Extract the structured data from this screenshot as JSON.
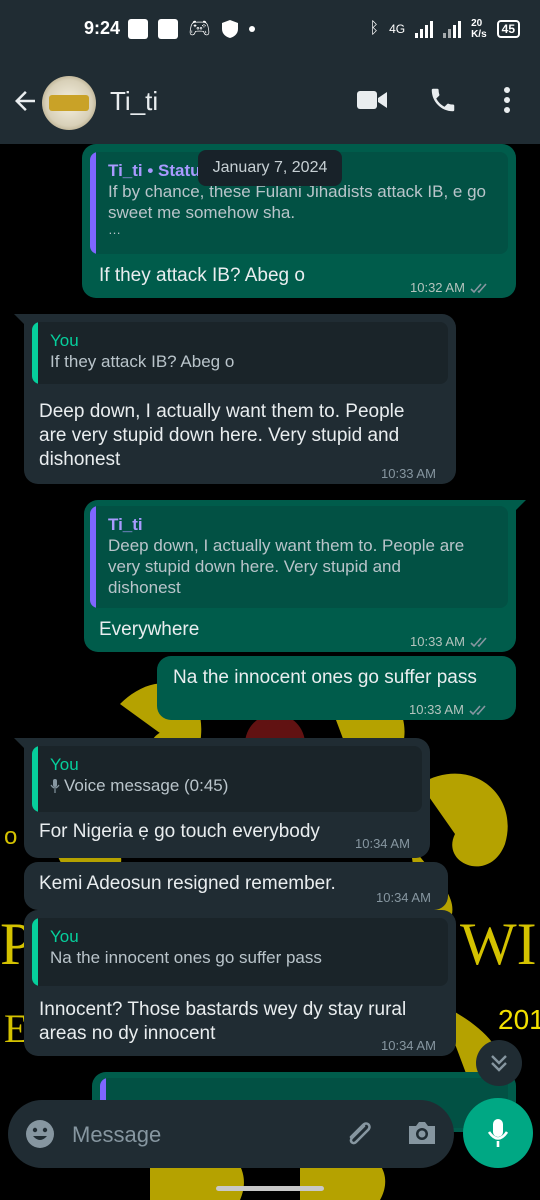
{
  "status_bar": {
    "time": "9:24",
    "network": "4G",
    "speed_value": "20",
    "speed_unit": "K/s",
    "battery": "45"
  },
  "header": {
    "contact_name": "Ti_ti",
    "icons": [
      "back-arrow-icon",
      "video-call-icon",
      "voice-call-icon",
      "more-options-icon"
    ]
  },
  "chat": {
    "date_chip": "January 7, 2024",
    "messages": [
      {
        "direction": "outgoing",
        "quote_author": "Ti_ti • Status",
        "quote_text": "If by chance, these Fulani Jihadists attack IB, e go sweet me somehow sha.",
        "quote_more": "…",
        "text": "If they attack IB? Abeg o",
        "time": "10:32 AM",
        "read": true
      },
      {
        "direction": "incoming",
        "quote_author": "You",
        "quote_text": "If they attack IB? Abeg o",
        "text_lines": [
          "Deep down, I actually want them to. People",
          "are very stupid down here. Very stupid and",
          "dishonest"
        ],
        "time": "10:33 AM"
      },
      {
        "direction": "outgoing",
        "quote_author": "Ti_ti",
        "quote_text_lines": [
          "Deep down, I actually want them to. People are",
          "very stupid down here. Very stupid and",
          "dishonest"
        ],
        "text": "Everywhere",
        "time": "10:33 AM",
        "read": true
      },
      {
        "direction": "outgoing",
        "text": "Na the innocent ones go suffer pass",
        "time": "10:33 AM",
        "read": true
      },
      {
        "direction": "incoming",
        "quote_author": "You",
        "quote_text": "Voice message (0:45)",
        "text": "For Nigeria ẹ go touch everybody",
        "time": "10:34 AM"
      },
      {
        "direction": "incoming",
        "text": "Kemi Adeosun resigned remember.",
        "time": "10:34 AM"
      },
      {
        "direction": "incoming",
        "quote_author": "You",
        "quote_text": "Na the innocent ones go suffer pass",
        "text_lines": [
          "Innocent? Those bastards wey dy stay rural",
          "areas no dy innocent"
        ],
        "time": "10:34 AM"
      }
    ]
  },
  "wallpaper": {
    "text_left_top": "P",
    "text_right_top": "WI",
    "text_left_bottom": "E",
    "text_right_bottom": "201",
    "text_small_left": "o"
  },
  "input": {
    "placeholder": "Message"
  },
  "colors": {
    "outgoing_bubble": "#005c4b",
    "incoming_bubble": "#202c33",
    "accent": "#00a884",
    "header_bg": "#202c33"
  }
}
